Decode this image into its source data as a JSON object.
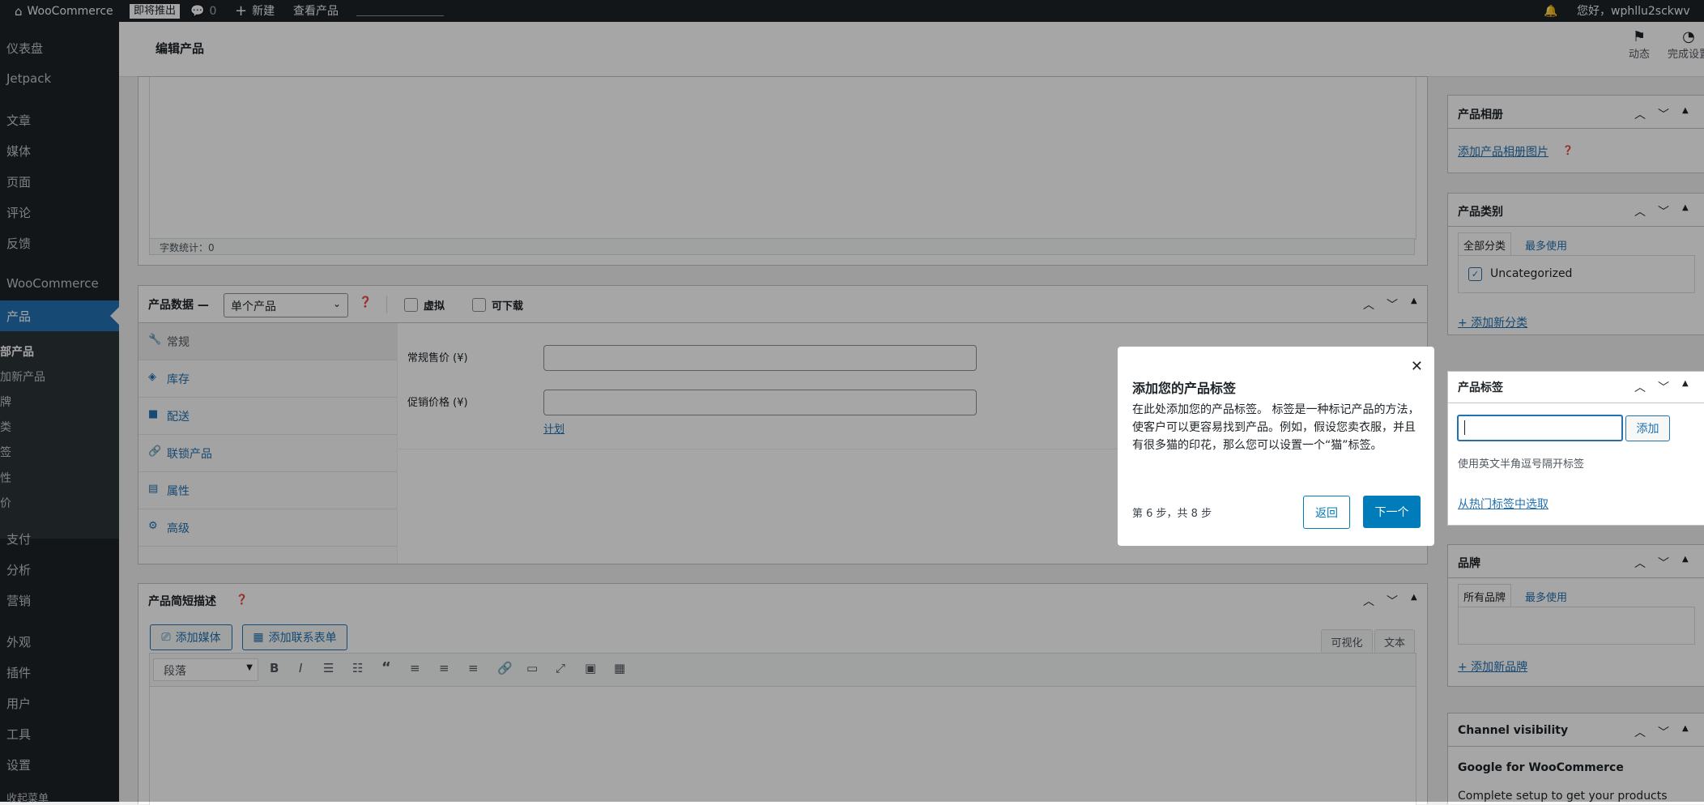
{
  "adminbar": {
    "site_name": "WooCommerce",
    "coming_soon": "即将推出",
    "comments_count": "0",
    "new_label": "新建",
    "view_product": "查看产品",
    "greeting": "您好，wphllu2sckwv"
  },
  "sidebar": {
    "dashboard": "仪表盘",
    "jetpack": "Jetpack",
    "posts": "文章",
    "media": "媒体",
    "pages": "页面",
    "comments": "评论",
    "feedback": "反馈",
    "woocommerce": "WooCommerce",
    "products": "产品",
    "submenu": [
      "部产品",
      "加新产品",
      "牌",
      "类",
      "签",
      "性",
      "价"
    ],
    "payments": "支付",
    "analytics": "分析",
    "marketing": "营销",
    "appearance": "外观",
    "plugins": "插件",
    "users": "用户",
    "tools": "工具",
    "settings": "设置",
    "collapse": "收起菜单"
  },
  "header": {
    "title": "编辑产品",
    "activity": "动态",
    "finish_setup": "完成设置"
  },
  "editor": {
    "word_count": "字数统计：0"
  },
  "product_data": {
    "title": "产品数据 —",
    "type_select": "单个产品",
    "virtual": "虚拟",
    "downloadable": "可下载",
    "tabs": [
      {
        "icon": "wrench-icon",
        "label": "常规"
      },
      {
        "icon": "tag-icon",
        "label": "库存"
      },
      {
        "icon": "truck-icon",
        "label": "配送"
      },
      {
        "icon": "link-icon",
        "label": "联锁产品"
      },
      {
        "icon": "list-icon",
        "label": "属性"
      },
      {
        "icon": "gear-icon",
        "label": "高级"
      }
    ],
    "regular_price_label": "常规售价 (¥)",
    "sale_price_label": "促销价格 (¥)",
    "schedule_link": "计划"
  },
  "short_desc": {
    "title": "产品简短描述",
    "add_media": "添加媒体",
    "add_form": "添加联系表单",
    "visual_tab": "可视化",
    "text_tab": "文本",
    "format_select": "段落"
  },
  "gallery": {
    "title": "产品相册",
    "add_link": "添加产品相册图片"
  },
  "categories": {
    "title": "产品类别",
    "tab_all": "全部分类",
    "tab_popular": "最多使用",
    "item": "Uncategorized",
    "add_new": "+ 添加新分类"
  },
  "tags": {
    "title": "产品标签",
    "add_button": "添加",
    "hint": "使用英文半角逗号隔开标签",
    "choose_popular": "从热门标签中选取"
  },
  "brands": {
    "title": "品牌",
    "tab_all": "所有品牌",
    "tab_popular": "最多使用",
    "add_new": "+ 添加新品牌"
  },
  "channel": {
    "title": "Channel visibility",
    "subtitle": "Google for WooCommerce",
    "text": "Complete setup to get your products"
  },
  "tour": {
    "title": "添加您的产品标签",
    "body": "在此处添加您的产品标签。 标签是一种标记产品的方法，使客户可以更容易找到产品。例如，假设您卖衣服，并且有很多猫的印花，那么您可以设置一个“猫”标签。",
    "step": "第 6 步，共 8 步",
    "back": "返回",
    "next": "下一个"
  },
  "colors": {
    "admin_dark": "#1d2327",
    "accent": "#2271b1",
    "tour_primary": "#007cba"
  }
}
